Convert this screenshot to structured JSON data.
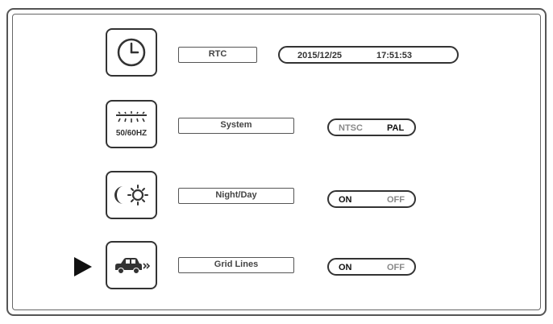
{
  "rows": [
    {
      "id": "rtc",
      "icon": "clock-icon",
      "label": "RTC",
      "value": {
        "date": "2015/12/25",
        "time": "17:51:53"
      }
    },
    {
      "id": "system",
      "icon": "frequency-50-60hz-icon",
      "icon_text": "50/60HZ",
      "label": "System",
      "options": [
        "NTSC",
        "PAL"
      ],
      "selected": "PAL"
    },
    {
      "id": "nightday",
      "icon": "moon-sun-icon",
      "label": "Night/Day",
      "options": [
        "ON",
        "OFF"
      ],
      "selected": "ON"
    },
    {
      "id": "gridlines",
      "icon": "car-grid-lines-icon",
      "label": "Grid Lines",
      "options": [
        "ON",
        "OFF"
      ],
      "selected": "ON"
    }
  ],
  "selected_row": "gridlines",
  "colors": {
    "line": "#333333",
    "background": "#ffffff"
  }
}
